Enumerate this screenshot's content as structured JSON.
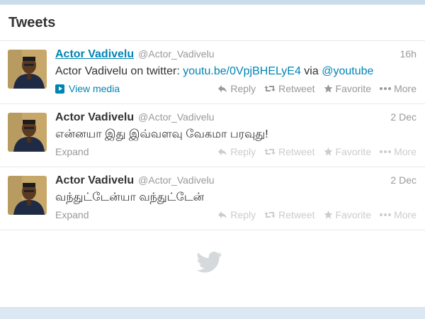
{
  "header": {
    "title": "Tweets"
  },
  "tweets": [
    {
      "name": "Actor Vadivelu",
      "handle": "@Actor_Vadivelu",
      "time": "16h",
      "text_prefix": "Actor Vadivelu on twitter: ",
      "link1": "youtu.be/0VpjBHELyE4",
      "via": " via ",
      "link2": "@youtube",
      "foot_label": "View media",
      "actions": {
        "reply": "Reply",
        "retweet": "Retweet",
        "favorite": "Favorite",
        "more": "More"
      }
    },
    {
      "name": "Actor Vadivelu",
      "handle": "@Actor_Vadivelu",
      "time": "2 Dec",
      "text": "என்னயா இது இவ்வளவு வேகமா பரவுது!",
      "foot_label": "Expand",
      "actions": {
        "reply": "Reply",
        "retweet": "Retweet",
        "favorite": "Favorite",
        "more": "More"
      }
    },
    {
      "name": "Actor Vadivelu",
      "handle": "@Actor_Vadivelu",
      "time": "2 Dec",
      "text": "வந்துட்டேன்யா வந்துட்டேன்",
      "foot_label": "Expand",
      "actions": {
        "reply": "Reply",
        "retweet": "Retweet",
        "favorite": "Favorite",
        "more": "More"
      }
    }
  ],
  "icons": {
    "reply": "reply-icon",
    "retweet": "retweet-icon",
    "favorite": "star-icon",
    "more": "more-dots-icon",
    "media": "play-icon",
    "footer": "twitter-bird-icon"
  },
  "colors": {
    "link": "#0084b4",
    "muted": "#999999",
    "text": "#333333",
    "background": "#c9dcec"
  }
}
